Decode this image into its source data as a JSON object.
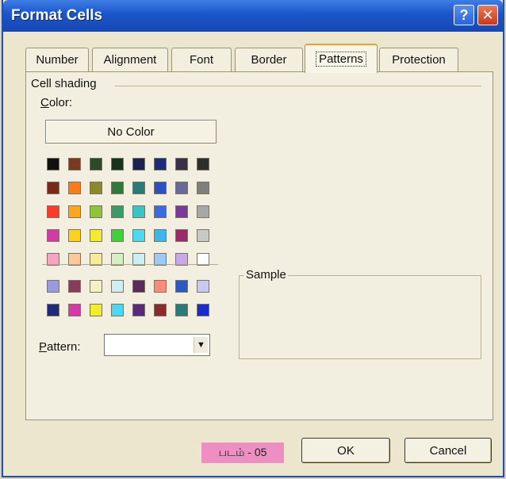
{
  "window": {
    "title": "Format Cells",
    "help_glyph": "?",
    "close_glyph": "✕"
  },
  "tabs": [
    {
      "label": "Number"
    },
    {
      "label": "Alignment"
    },
    {
      "label": "Font"
    },
    {
      "label": "Border"
    },
    {
      "label": "Patterns",
      "active": true
    },
    {
      "label": "Protection"
    }
  ],
  "shading": {
    "group_label": "Cell shading",
    "color_label_first": "C",
    "color_label_rest": "olor:",
    "no_color_label": "No Color",
    "palette_rows": [
      [
        "#111111",
        "#7a3a20",
        "#2a4a2a",
        "#16331c",
        "#1a2350",
        "#1f2d78",
        "#3a3047",
        "#2e2e2e"
      ],
      [
        "#7a2a1a",
        "#ff7a1a",
        "#8a8a2a",
        "#2f7a3a",
        "#2a7a7a",
        "#2d4fc0",
        "#6a6a9a",
        "#7f7f7f"
      ],
      [
        "#ff3a2a",
        "#ffa51f",
        "#8ec43a",
        "#3a9a6a",
        "#3ac4c4",
        "#3a6ae0",
        "#7a3a9a",
        "#a8a8a8"
      ],
      [
        "#d43aa5",
        "#ffd21a",
        "#f2ec2a",
        "#3ed23a",
        "#4ad8f2",
        "#39b8ec",
        "#9a2a6a",
        "#c8c8c8"
      ],
      [
        "#f6a3c4",
        "#ffc89a",
        "#f6eb9a",
        "#d6f0c6",
        "#cdeef2",
        "#9ec9f2",
        "#c8a8e6",
        "#ffffff"
      ]
    ],
    "chart_rows": [
      [
        "#9a9ae0",
        "#8a3a5a",
        "#f6f0c6",
        "#cdeef2",
        "#5a2a5a",
        "#ff8a7a",
        "#2a5ac4",
        "#c8c8f2"
      ],
      [
        "#1f2a78",
        "#d43aa5",
        "#f2ec2a",
        "#4ad8f2",
        "#5a2a7a",
        "#8a2a2a",
        "#2a7a7a",
        "#1a2ad0"
      ]
    ]
  },
  "pattern": {
    "label_first": "P",
    "label_rest": "attern:",
    "value": "",
    "dropdown_glyph": "▼"
  },
  "sample": {
    "label": "Sample"
  },
  "caption": "படம் - 05",
  "buttons": {
    "ok": "OK",
    "cancel": "Cancel"
  }
}
